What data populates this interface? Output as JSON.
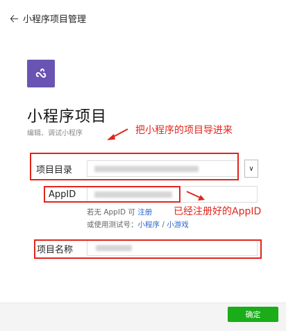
{
  "header": {
    "back_icon": "arrow-left-icon",
    "title": "小程序项目管理"
  },
  "logo": {
    "icon": "miniprogram-logo-icon",
    "color": "#6a54b3"
  },
  "page": {
    "title": "小程序项目",
    "subtitle": "编辑、调试小程序"
  },
  "form": {
    "dir_label": "项目目录",
    "appid_label": "AppID",
    "name_label": "项目名称",
    "hint_line1_prefix": "若无 AppID 可",
    "hint_register": "注册",
    "hint_line2_prefix": "或使用测试号：",
    "hint_miniprogram": "小程序",
    "hint_sep": " / ",
    "hint_minigame": "小游戏",
    "dropdown_icon": "chevron-down-icon"
  },
  "annotations": {
    "import_note": "把小程序的项目导进来",
    "appid_note": "已经注册好的AppID",
    "color": "#e0251b"
  },
  "footer": {
    "confirm_label": "确定",
    "confirm_color": "#1aad19"
  }
}
